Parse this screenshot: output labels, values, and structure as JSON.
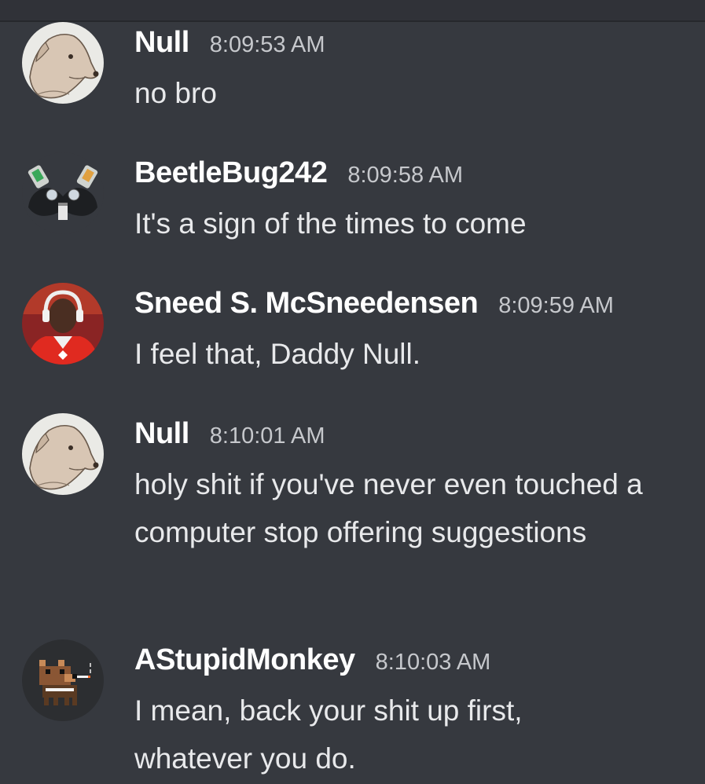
{
  "messages": [
    {
      "username": "Null",
      "timestamp": "8:09:53 AM",
      "text": "no bro",
      "avatar_icon": "dog-sketch-avatar"
    },
    {
      "username": "BeetleBug242",
      "timestamp": "8:09:58 AM",
      "text": "It's a sign of the times to come",
      "avatar_icon": "beetle-robot-avatar"
    },
    {
      "username": "Sneed S. McSneedensen",
      "timestamp": "8:09:59 AM",
      "text": "I feel that, Daddy Null.",
      "avatar_icon": "football-player-avatar"
    },
    {
      "username": "Null",
      "timestamp": "8:10:01 AM",
      "text": "holy shit if you've never even touched a computer stop offering suggestions",
      "avatar_icon": "dog-sketch-avatar"
    },
    {
      "username": "AStupidMonkey",
      "timestamp": "8:10:03 AM",
      "text": "I mean, back your shit up first, whatever you do.",
      "avatar_icon": "pixel-dog-avatar"
    }
  ],
  "colors": {
    "background": "#36393f",
    "username": "#ffffff",
    "timestamp": "#c6c8cc",
    "message_text": "#e8e9eb"
  }
}
